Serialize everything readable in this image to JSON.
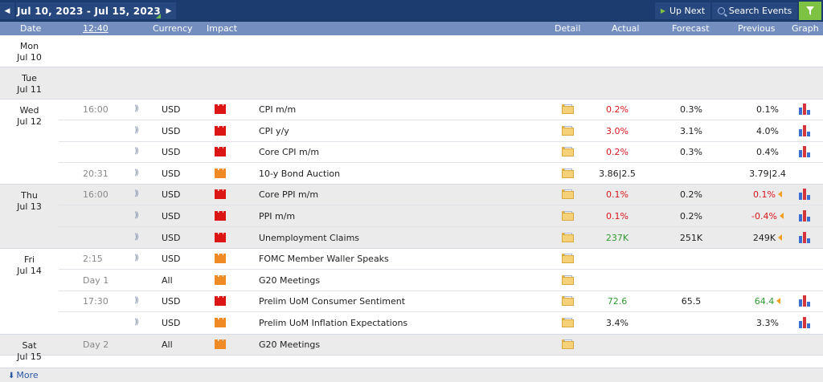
{
  "toolbar": {
    "prev_icon": "triangle-left-icon",
    "date_range": "Jul 10, 2023 - Jul 15, 2023",
    "next_icon": "triangle-right-icon",
    "up_next": "Up Next",
    "search_events": "Search Events",
    "filter_icon": "funnel-icon"
  },
  "columns": {
    "date": "Date",
    "time": "12:40",
    "currency": "Currency",
    "impact": "Impact",
    "detail": "Detail",
    "actual": "Actual",
    "forecast": "Forecast",
    "previous": "Previous",
    "graph": "Graph"
  },
  "days": [
    {
      "dow": "Mon",
      "date": "Jul 10",
      "events": []
    },
    {
      "dow": "Tue",
      "date": "Jul 11",
      "events": []
    },
    {
      "dow": "Wed",
      "date": "Jul 12",
      "events": [
        {
          "time": "16:00",
          "currency": "USD",
          "impact": "high",
          "title": "CPI m/m",
          "actual": "0.2%",
          "actual_color": "red",
          "forecast": "0.3%",
          "previous": "0.1%",
          "previous_color": "",
          "revised": false,
          "graph": true
        },
        {
          "time": "",
          "currency": "USD",
          "impact": "high",
          "title": "CPI y/y",
          "actual": "3.0%",
          "actual_color": "red",
          "forecast": "3.1%",
          "previous": "4.0%",
          "previous_color": "",
          "revised": false,
          "graph": true
        },
        {
          "time": "",
          "currency": "USD",
          "impact": "high",
          "title": "Core CPI m/m",
          "actual": "0.2%",
          "actual_color": "red",
          "forecast": "0.3%",
          "previous": "0.4%",
          "previous_color": "",
          "revised": false,
          "graph": true
        },
        {
          "time": "20:31",
          "currency": "USD",
          "impact": "med",
          "title": "10-y Bond Auction",
          "actual": "3.86|2.5",
          "actual_color": "",
          "forecast": "",
          "previous": "3.79|2.4",
          "previous_color": "",
          "revised": false,
          "graph": false
        }
      ]
    },
    {
      "dow": "Thu",
      "date": "Jul 13",
      "events": [
        {
          "time": "16:00",
          "currency": "USD",
          "impact": "high",
          "title": "Core PPI m/m",
          "actual": "0.1%",
          "actual_color": "red",
          "forecast": "0.2%",
          "previous": "0.1%",
          "previous_color": "red",
          "revised": true,
          "graph": true
        },
        {
          "time": "",
          "currency": "USD",
          "impact": "high",
          "title": "PPI m/m",
          "actual": "0.1%",
          "actual_color": "red",
          "forecast": "0.2%",
          "previous": "-0.4%",
          "previous_color": "red",
          "revised": true,
          "graph": true
        },
        {
          "time": "",
          "currency": "USD",
          "impact": "high",
          "title": "Unemployment Claims",
          "actual": "237K",
          "actual_color": "green",
          "forecast": "251K",
          "previous": "249K",
          "previous_color": "",
          "revised": true,
          "graph": true
        }
      ]
    },
    {
      "dow": "Fri",
      "date": "Jul 14",
      "events": [
        {
          "time": "2:15",
          "currency": "USD",
          "impact": "med",
          "title": "FOMC Member Waller Speaks",
          "actual": "",
          "actual_color": "",
          "forecast": "",
          "previous": "",
          "previous_color": "",
          "revised": false,
          "graph": false
        },
        {
          "time": "Day 1",
          "currency": "All",
          "impact": "med",
          "title": "G20 Meetings",
          "actual": "",
          "actual_color": "",
          "forecast": "",
          "previous": "",
          "previous_color": "",
          "revised": false,
          "graph": false
        },
        {
          "time": "17:30",
          "currency": "USD",
          "impact": "high",
          "title": "Prelim UoM Consumer Sentiment",
          "actual": "72.6",
          "actual_color": "green",
          "forecast": "65.5",
          "previous": "64.4",
          "previous_color": "green",
          "revised": true,
          "graph": true
        },
        {
          "time": "",
          "currency": "USD",
          "impact": "med",
          "title": "Prelim UoM Inflation Expectations",
          "actual": "3.4%",
          "actual_color": "",
          "forecast": "",
          "previous": "3.3%",
          "previous_color": "",
          "revised": false,
          "graph": true
        }
      ]
    },
    {
      "dow": "Sat",
      "date": "Jul 15",
      "events": [
        {
          "time": "Day 2",
          "currency": "All",
          "impact": "med",
          "title": "G20 Meetings",
          "actual": "",
          "actual_color": "",
          "forecast": "",
          "previous": "",
          "previous_color": "",
          "revised": false,
          "graph": false
        }
      ]
    }
  ],
  "footer": {
    "more": "More"
  }
}
